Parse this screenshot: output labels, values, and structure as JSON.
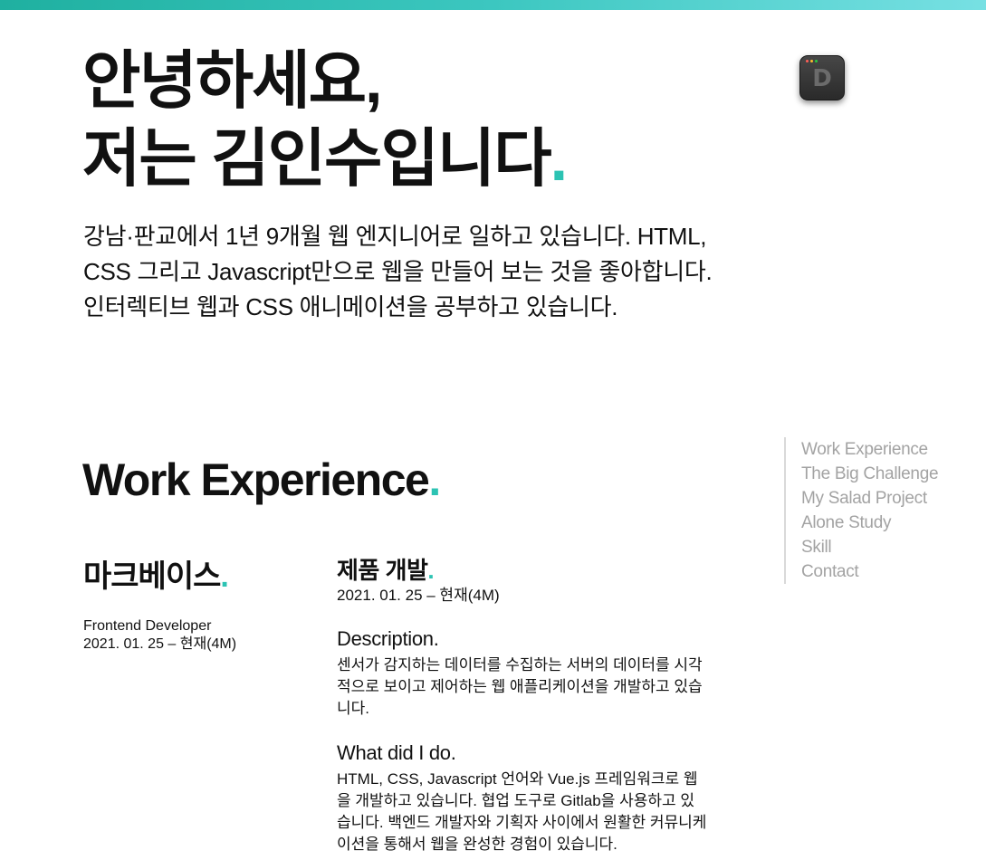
{
  "hero": {
    "line1": "안녕하세요,",
    "line2": "저는 김인수입니다",
    "dot": ".",
    "intro": "강남·판교에서 1년 9개월 웹 엔지니어로 일하고 있습니다. HTML, CSS 그리고 Javascript만으로 웹을 만들어 보는 것을 좋아합니다. 인터렉티브 웹과 CSS 애니메이션을 공부하고 있습니다."
  },
  "app_icon": {
    "letter": "D",
    "icon": "dev-app-icon",
    "light_colors": [
      "#ff5f57",
      "#febc2e",
      "#28c840"
    ]
  },
  "nav": {
    "items": [
      {
        "label": "Work Experience"
      },
      {
        "label": "The Big Challenge"
      },
      {
        "label": "My Salad Project"
      },
      {
        "label": "Alone Study"
      },
      {
        "label": "Skill"
      },
      {
        "label": "Contact"
      }
    ]
  },
  "work": {
    "title": "Work Experience",
    "company": {
      "name": "마크베이스",
      "role": "Frontend Developer",
      "period": "2021. 01. 25 – 현재(4M)"
    },
    "project": {
      "title": "제품 개발",
      "period": "2021. 01. 25 – 현재(4M)",
      "description_label": "Description.",
      "description": "센서가 감지하는 데이터를 수집하는 서버의 데이터를 시각적으로 보이고 제어하는 웹 애플리케이션을 개발하고 있습니다.",
      "did_label": "What did I do.",
      "did": "HTML, CSS, Javascript 언어와 Vue.js 프레임워크로 웹을 개발하고 있습니다. 협업 도구로 Gitlab을 사용하고 있습니다. 백엔드 개발자와 기획자 사이에서 원활한 커뮤니케이션을 통해서 웹을 완성한 경험이 있습니다."
    }
  },
  "colors": {
    "accent": "#2cc3b3",
    "nav_text": "#a3a3a3",
    "top_bar_start": "#1fb0a0",
    "top_bar_end": "#77e0e3"
  }
}
